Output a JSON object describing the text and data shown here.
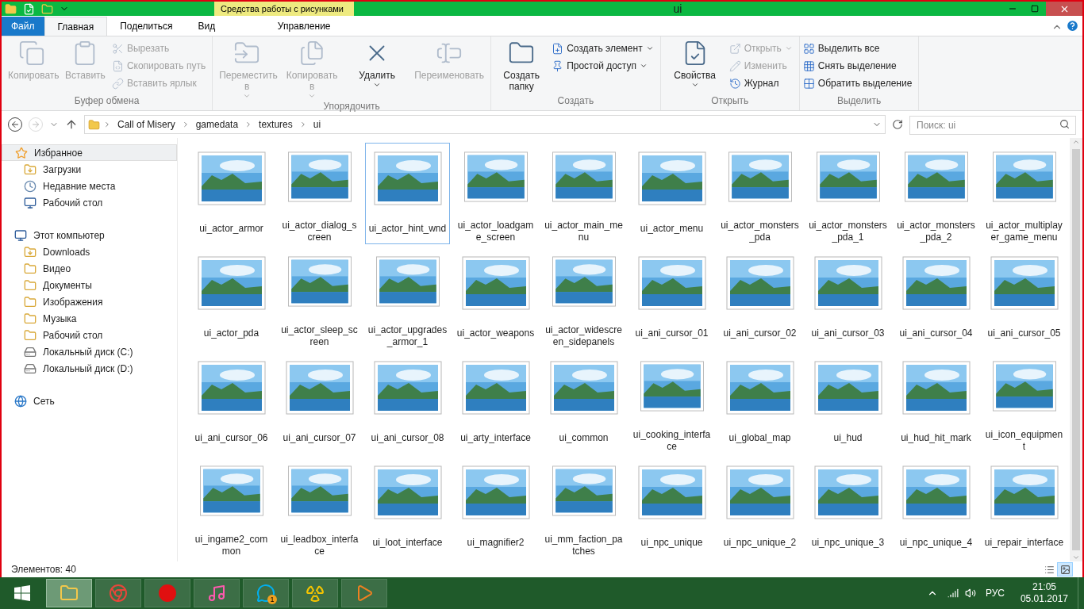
{
  "window": {
    "title": "ui",
    "context_tab": "Средства работы с рисунками"
  },
  "tabs": [
    {
      "label": "Файл",
      "kind": "file",
      "selected": false
    },
    {
      "label": "Главная",
      "kind": "normal",
      "selected": true
    },
    {
      "label": "Поделиться",
      "kind": "normal",
      "selected": false
    },
    {
      "label": "Вид",
      "kind": "normal",
      "selected": false
    },
    {
      "label": "Управление",
      "kind": "context",
      "selected": false
    }
  ],
  "ribbon": [
    {
      "label": "Буфер обмена",
      "items": [
        {
          "kind": "large",
          "label": "Копировать",
          "disabled": true
        },
        {
          "kind": "large",
          "label": "Вставить",
          "disabled": true
        },
        {
          "kind": "stack",
          "items": [
            {
              "label": "Вырезать",
              "disabled": true,
              "dropdown": false
            },
            {
              "label": "Скопировать путь",
              "disabled": true,
              "dropdown": false
            },
            {
              "label": "Вставить ярлык",
              "disabled": true,
              "dropdown": false
            }
          ]
        }
      ]
    },
    {
      "label": "Упорядочить",
      "items": [
        {
          "kind": "large",
          "label": "Переместить в",
          "disabled": true,
          "dropdown": true
        },
        {
          "kind": "large",
          "label": "Копировать в",
          "disabled": true,
          "dropdown": true
        },
        {
          "kind": "large",
          "label": "Удалить",
          "disabled": false,
          "dropdown": true
        },
        {
          "kind": "large",
          "label": "Переименовать",
          "disabled": true,
          "dropdown": false
        }
      ]
    },
    {
      "label": "Создать",
      "items": [
        {
          "kind": "large",
          "label": "Создать папку",
          "disabled": false,
          "dropdown": false
        },
        {
          "kind": "stack",
          "items": [
            {
              "label": "Создать элемент",
              "disabled": false,
              "dropdown": true
            },
            {
              "label": "Простой доступ",
              "disabled": false,
              "dropdown": true
            }
          ]
        }
      ]
    },
    {
      "label": "Открыть",
      "items": [
        {
          "kind": "large",
          "label": "Свойства",
          "disabled": false,
          "dropdown": true
        },
        {
          "kind": "stack",
          "items": [
            {
              "label": "Открыть",
              "disabled": true,
              "dropdown": true
            },
            {
              "label": "Изменить",
              "disabled": true,
              "dropdown": false
            },
            {
              "label": "Журнал",
              "disabled": false,
              "dropdown": false
            }
          ]
        }
      ]
    },
    {
      "label": "Выделить",
      "items": [
        {
          "kind": "stack",
          "items": [
            {
              "label": "Выделить все",
              "disabled": false,
              "dropdown": false
            },
            {
              "label": "Снять выделение",
              "disabled": false,
              "dropdown": false
            },
            {
              "label": "Обратить выделение",
              "disabled": false,
              "dropdown": false
            }
          ]
        }
      ]
    }
  ],
  "address": {
    "crumbs": [
      "Call of Misery",
      "gamedata",
      "textures",
      "ui"
    ],
    "search_placeholder": "Поиск: ui"
  },
  "sidebar": [
    {
      "label": "Избранное",
      "kind": "star",
      "selected": true,
      "children": [
        {
          "label": "Загрузки",
          "kind": "download",
          "selected": false
        },
        {
          "label": "Недавние места",
          "kind": "recent",
          "selected": false
        },
        {
          "label": "Рабочий стол",
          "kind": "desktop",
          "selected": false
        }
      ]
    },
    {
      "label": "Этот компьютер",
      "kind": "computer",
      "selected": false,
      "children": [
        {
          "label": "Downloads",
          "kind": "download",
          "selected": false
        },
        {
          "label": "Видео",
          "kind": "folder",
          "selected": false
        },
        {
          "label": "Документы",
          "kind": "folder",
          "selected": false
        },
        {
          "label": "Изображения",
          "kind": "folder",
          "selected": false
        },
        {
          "label": "Музыка",
          "kind": "folder",
          "selected": false
        },
        {
          "label": "Рабочий стол",
          "kind": "folder",
          "selected": false
        },
        {
          "label": "Локальный диск (C:)",
          "kind": "drive",
          "selected": false
        },
        {
          "label": "Локальный диск (D:)",
          "kind": "drive",
          "selected": false
        }
      ]
    },
    {
      "label": "Сеть",
      "kind": "network",
      "selected": false
    }
  ],
  "files": [
    {
      "name": "ui_actor_armor",
      "selected": false
    },
    {
      "name": "ui_actor_dialog_screen",
      "selected": false
    },
    {
      "name": "ui_actor_hint_wnd",
      "selected": true
    },
    {
      "name": "ui_actor_loadgame_screen",
      "selected": false
    },
    {
      "name": "ui_actor_main_menu",
      "selected": false
    },
    {
      "name": "ui_actor_menu",
      "selected": false
    },
    {
      "name": "ui_actor_monsters_pda",
      "selected": false
    },
    {
      "name": "ui_actor_monsters_pda_1",
      "selected": false
    },
    {
      "name": "ui_actor_monsters_pda_2",
      "selected": false
    },
    {
      "name": "ui_actor_multiplayer_game_menu",
      "selected": false
    },
    {
      "name": "ui_actor_pda",
      "selected": false
    },
    {
      "name": "ui_actor_sleep_screen",
      "selected": false
    },
    {
      "name": "ui_actor_upgrades_armor_1",
      "selected": false
    },
    {
      "name": "ui_actor_weapons",
      "selected": false
    },
    {
      "name": "ui_actor_widescreen_sidepanels",
      "selected": false
    },
    {
      "name": "ui_ani_cursor_01",
      "selected": false
    },
    {
      "name": "ui_ani_cursor_02",
      "selected": false
    },
    {
      "name": "ui_ani_cursor_03",
      "selected": false
    },
    {
      "name": "ui_ani_cursor_04",
      "selected": false
    },
    {
      "name": "ui_ani_cursor_05",
      "selected": false
    },
    {
      "name": "ui_ani_cursor_06",
      "selected": false
    },
    {
      "name": "ui_ani_cursor_07",
      "selected": false
    },
    {
      "name": "ui_ani_cursor_08",
      "selected": false
    },
    {
      "name": "ui_arty_interface",
      "selected": false
    },
    {
      "name": "ui_common",
      "selected": false
    },
    {
      "name": "ui_cooking_interface",
      "selected": false
    },
    {
      "name": "ui_global_map",
      "selected": false
    },
    {
      "name": "ui_hud",
      "selected": false
    },
    {
      "name": "ui_hud_hit_mark",
      "selected": false
    },
    {
      "name": "ui_icon_equipment",
      "selected": false
    },
    {
      "name": "ui_ingame2_common",
      "selected": false
    },
    {
      "name": "ui_leadbox_interface",
      "selected": false
    },
    {
      "name": "ui_loot_interface",
      "selected": false
    },
    {
      "name": "ui_magnifier2",
      "selected": false
    },
    {
      "name": "ui_mm_faction_patches",
      "selected": false
    },
    {
      "name": "ui_npc_unique",
      "selected": false
    },
    {
      "name": "ui_npc_unique_2",
      "selected": false
    },
    {
      "name": "ui_npc_unique_3",
      "selected": false
    },
    {
      "name": "ui_npc_unique_4",
      "selected": false
    },
    {
      "name": "ui_repair_interface",
      "selected": false
    }
  ],
  "status": "Элементов: 40",
  "views": [
    {
      "kind": "details",
      "selected": false
    },
    {
      "kind": "icons",
      "selected": true
    }
  ],
  "taskbar": {
    "apps": [
      {
        "kind": "explorer",
        "selected": true
      },
      {
        "kind": "browser",
        "selected": false
      },
      {
        "kind": "record",
        "selected": false
      },
      {
        "kind": "media",
        "selected": false
      },
      {
        "kind": "messenger",
        "selected": false,
        "badge": "1"
      },
      {
        "kind": "radiation",
        "selected": false
      },
      {
        "kind": "player",
        "selected": false
      }
    ],
    "lang": "РУС",
    "time": "21:05",
    "date": "05.01.2017"
  }
}
